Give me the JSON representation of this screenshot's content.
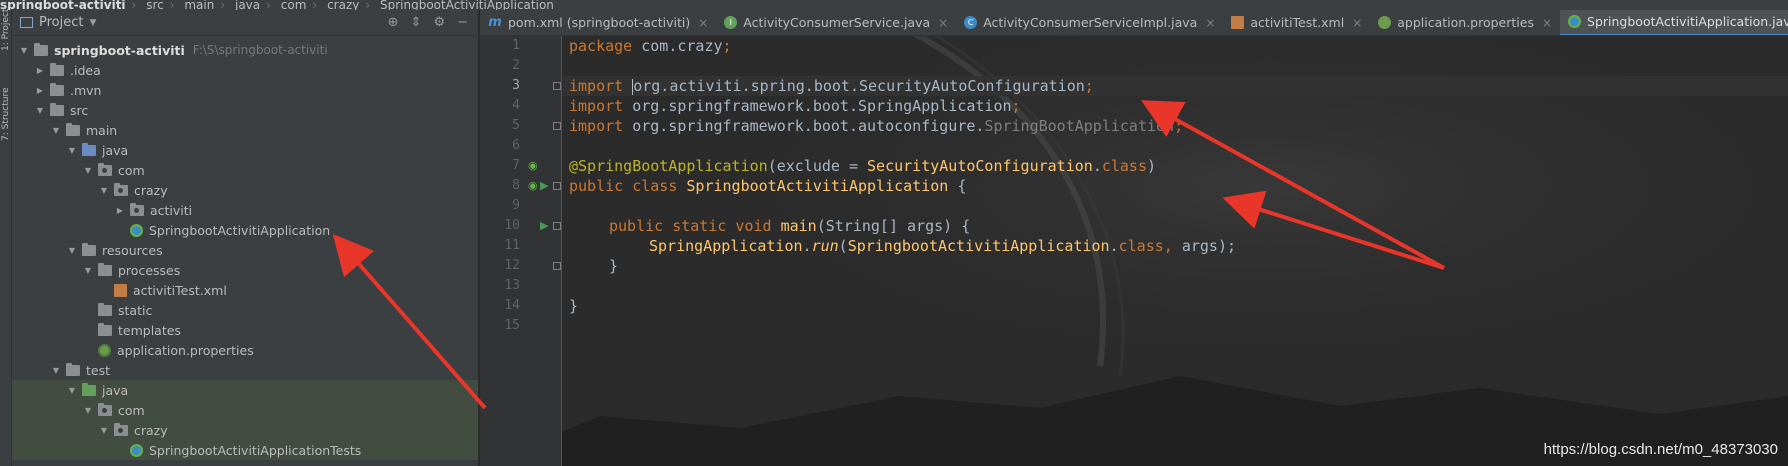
{
  "breadcrumb": [
    "springboot-activiti",
    "src",
    "main",
    "java",
    "com",
    "crazy",
    "SpringbootActivitiApplication"
  ],
  "left_strip": {
    "project_label": "1: Project",
    "structure_label": "7: Structure"
  },
  "project_panel": {
    "title": "Project",
    "tree": [
      {
        "label": "springboot-activiti",
        "hint": "F:\\S\\springboot-activiti",
        "depth": 0,
        "arrow": "down",
        "icon": "folder",
        "bold": true
      },
      {
        "label": ".idea",
        "depth": 1,
        "arrow": "right",
        "icon": "folder"
      },
      {
        "label": ".mvn",
        "depth": 1,
        "arrow": "right",
        "icon": "folder"
      },
      {
        "label": "src",
        "depth": 1,
        "arrow": "down",
        "icon": "folder"
      },
      {
        "label": "main",
        "depth": 2,
        "arrow": "down",
        "icon": "folder"
      },
      {
        "label": "java",
        "depth": 3,
        "arrow": "down",
        "icon": "folder-blue"
      },
      {
        "label": "com",
        "depth": 4,
        "arrow": "down",
        "icon": "package"
      },
      {
        "label": "crazy",
        "depth": 5,
        "arrow": "down",
        "icon": "package"
      },
      {
        "label": "activiti",
        "depth": 6,
        "arrow": "right",
        "icon": "package"
      },
      {
        "label": "SpringbootActivitiApplication",
        "depth": 6,
        "arrow": "none",
        "icon": "spring-class"
      },
      {
        "label": "resources",
        "depth": 3,
        "arrow": "down",
        "icon": "folder"
      },
      {
        "label": "processes",
        "depth": 4,
        "arrow": "down",
        "icon": "folder"
      },
      {
        "label": "activitiTest.xml",
        "depth": 5,
        "arrow": "none",
        "icon": "xml-file"
      },
      {
        "label": "static",
        "depth": 4,
        "arrow": "none",
        "icon": "folder"
      },
      {
        "label": "templates",
        "depth": 4,
        "arrow": "none",
        "icon": "folder"
      },
      {
        "label": "application.properties",
        "depth": 4,
        "arrow": "none",
        "icon": "properties-file"
      },
      {
        "label": "test",
        "depth": 2,
        "arrow": "down",
        "icon": "folder"
      },
      {
        "label": "java",
        "depth": 3,
        "arrow": "down",
        "icon": "folder-green"
      },
      {
        "label": "com",
        "depth": 4,
        "arrow": "down",
        "icon": "package"
      },
      {
        "label": "crazy",
        "depth": 5,
        "arrow": "down",
        "icon": "package"
      },
      {
        "label": "SpringbootActivitiApplicationTests",
        "depth": 6,
        "arrow": "none",
        "icon": "spring-class"
      }
    ]
  },
  "tabs": [
    {
      "label": "pom.xml (springboot-activiti)",
      "icon": "maven-icon",
      "active": false
    },
    {
      "label": "ActivityConsumerService.java",
      "icon": "interface-icon",
      "active": false
    },
    {
      "label": "ActivityConsumerServiceImpl.java",
      "icon": "class-icon",
      "active": false
    },
    {
      "label": "activitiTest.xml",
      "icon": "xml-icon",
      "active": false
    },
    {
      "label": "application.properties",
      "icon": "properties-icon",
      "active": false
    },
    {
      "label": "SpringbootActivitiApplication.java",
      "icon": "spring-class-icon",
      "active": true
    }
  ],
  "editor": {
    "line_numbers": [
      "1",
      "2",
      "3",
      "4",
      "5",
      "6",
      "7",
      "8",
      "9",
      "10",
      "11",
      "12",
      "13",
      "14",
      "15"
    ],
    "current_line": "3",
    "code": {
      "l1": {
        "kw": "package",
        "rest": " com.crazy",
        "semi": ";"
      },
      "l3": {
        "kw": "import",
        "pkg": "org.activiti.spring.boot.SecurityAutoConfiguration",
        "semi": ";"
      },
      "l4": {
        "kw": "import",
        "pkg": "org.springframework.boot.SpringApplication",
        "semi": ";"
      },
      "l5": {
        "kw": "import",
        "pkg": "org.springframework.boot.autoconfigure.",
        "dim": "SpringBootApplication",
        "semi": ";"
      },
      "l7": {
        "annotation": "@SpringBootApplication",
        "open": "(",
        "param": "exclude",
        "eq": " = ",
        "cls": "SecurityAutoConfiguration",
        "dot": ".",
        "kw": "class",
        "close": ")"
      },
      "l8": {
        "kw": "public class ",
        "cls": "SpringbootActivitiApplication",
        "brace": " {"
      },
      "l10": {
        "kw": "public static void ",
        "fn": "main",
        "args": "(String[] ",
        "param": "args",
        "close": ") {"
      },
      "l11": {
        "cls": "SpringApplication",
        "dot": ".",
        "method": "run",
        "open": "(",
        "cls2": "SpringbootActivitiApplication",
        "dot2": ".",
        "kw": "class",
        "comma": ", ",
        "arg": "args",
        "close": ");"
      },
      "l12": {
        "brace": "}"
      },
      "l14": {
        "brace": "}"
      }
    }
  },
  "watermark": "https://blog.csdn.net/m0_48373030",
  "colors": {
    "arrow": "#e8362a",
    "keyword": "#cc7832",
    "annotation": "#bbb529",
    "class_ref": "#ffc66d",
    "active_tab_underline": "#4a88c7"
  }
}
